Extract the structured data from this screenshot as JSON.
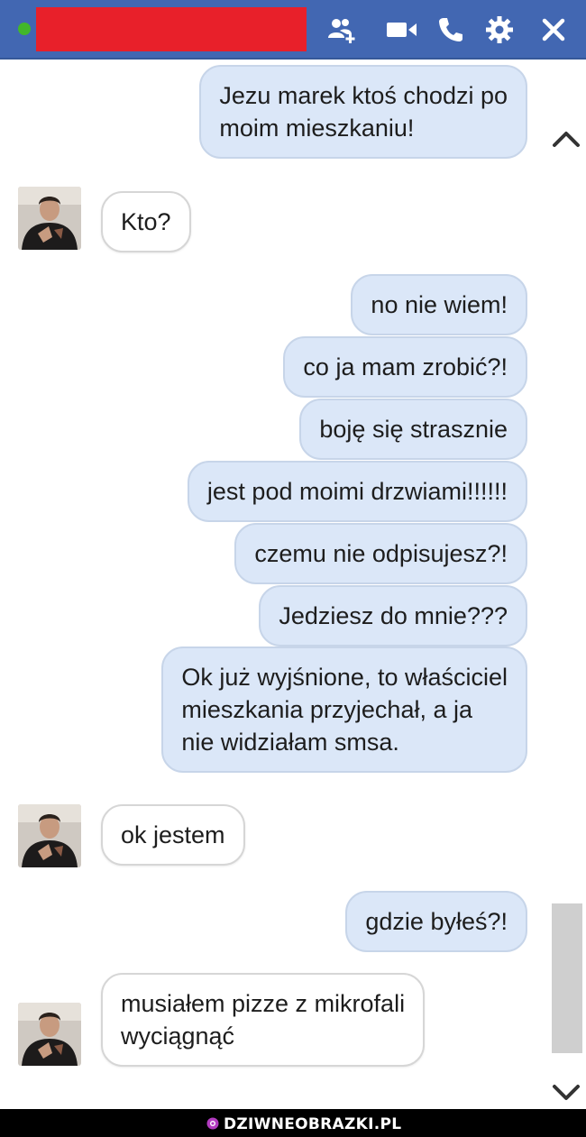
{
  "header": {
    "status_color": "#42b72a",
    "name_redaction_color": "#e8202a",
    "icons": [
      "add-friend-icon",
      "video-call-icon",
      "phone-icon",
      "gear-icon",
      "close-icon"
    ]
  },
  "messages": [
    {
      "dir": "out",
      "lines": [
        "Jezu marek ktoś chodzi po",
        "moim mieszkaniu!"
      ]
    },
    {
      "dir": "in",
      "lines": [
        "Kto?"
      ]
    },
    {
      "dir": "out",
      "lines": [
        "no nie wiem!"
      ]
    },
    {
      "dir": "out",
      "lines": [
        "co ja mam zrobić?!"
      ]
    },
    {
      "dir": "out",
      "lines": [
        "boję się strasznie"
      ]
    },
    {
      "dir": "out",
      "lines": [
        "jest pod moimi drzwiami!!!!!!"
      ]
    },
    {
      "dir": "out",
      "lines": [
        "czemu nie odpisujesz?!"
      ]
    },
    {
      "dir": "out",
      "lines": [
        "Jedziesz do mnie???"
      ]
    },
    {
      "dir": "out",
      "lines": [
        "Ok już wyjśnione, to właściciel",
        "mieszkania przyjechał, a ja",
        "nie widziałam smsa."
      ]
    },
    {
      "dir": "in",
      "lines": [
        "ok jestem"
      ]
    },
    {
      "dir": "out",
      "lines": [
        "gdzie byłeś?!"
      ]
    },
    {
      "dir": "in",
      "lines": [
        "musiałem pizze z mikrofali",
        "wyciągnąć"
      ]
    }
  ],
  "watermark": {
    "text": "DZIWNEOBRAZKI.PL"
  },
  "colors": {
    "header_bg": "#4267b2",
    "outgoing_bubble": "#dbe7f8",
    "incoming_bubble": "#ffffff"
  }
}
